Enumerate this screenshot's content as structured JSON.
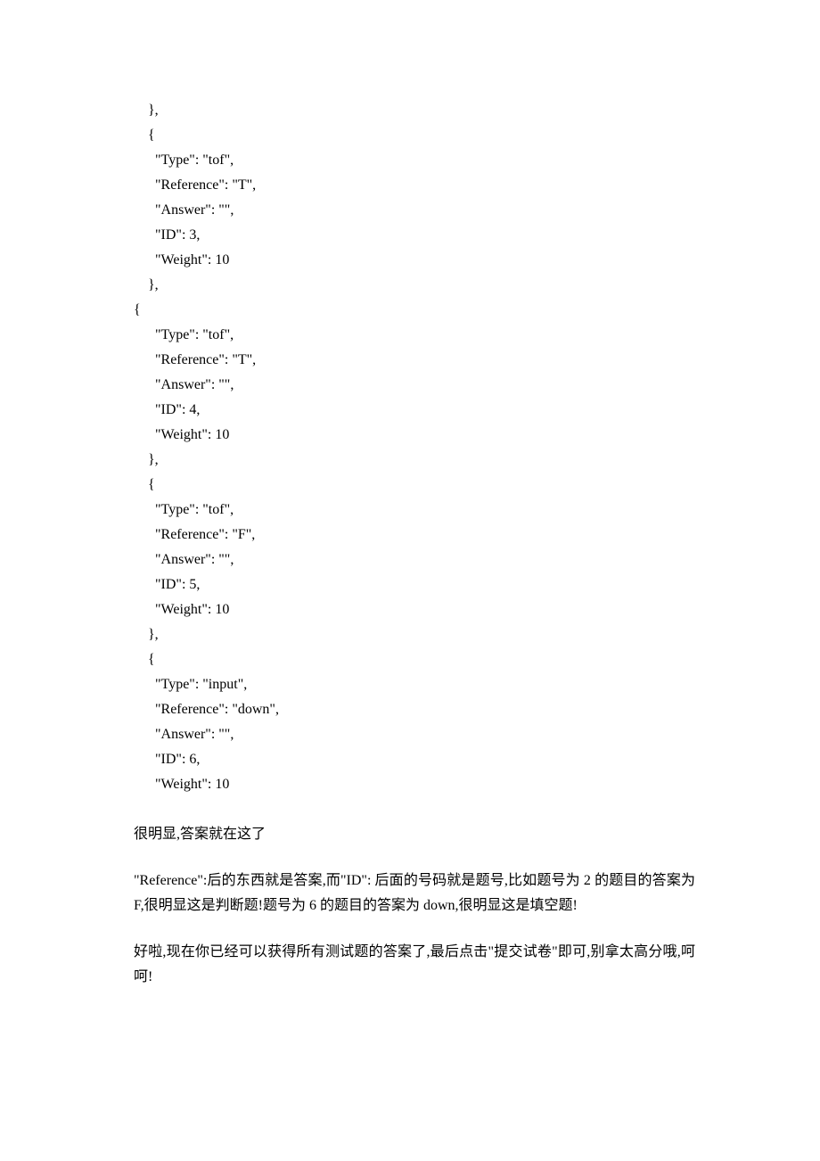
{
  "code": {
    "lines": [
      "    },",
      "    {",
      "      \"Type\": \"tof\",",
      "      \"Reference\": \"T\",",
      "      \"Answer\": \"\",",
      "      \"ID\": 3,",
      "      \"Weight\": 10",
      "    },",
      "{",
      "      \"Type\": \"tof\",",
      "      \"Reference\": \"T\",",
      "      \"Answer\": \"\",",
      "      \"ID\": 4,",
      "      \"Weight\": 10",
      "    },",
      "    {",
      "      \"Type\": \"tof\",",
      "      \"Reference\": \"F\",",
      "      \"Answer\": \"\",",
      "      \"ID\": 5,",
      "      \"Weight\": 10",
      "    },",
      "    {",
      "      \"Type\": \"input\",",
      "      \"Reference\": \"down\",",
      "      \"Answer\": \"\",",
      "      \"ID\": 6,",
      "      \"Weight\": 10"
    ]
  },
  "paragraphs": {
    "p1": "很明显,答案就在这了",
    "p2": "\"Reference\":后的东西就是答案,而\"ID\": 后面的号码就是题号,比如题号为 2 的题目的答案为 F,很明显这是判断题!题号为 6 的题目的答案为 down,很明显这是填空题!",
    "p3": "好啦,现在你已经可以获得所有测试题的答案了,最后点击\"提交试卷\"即可,别拿太高分哦,呵呵!"
  }
}
